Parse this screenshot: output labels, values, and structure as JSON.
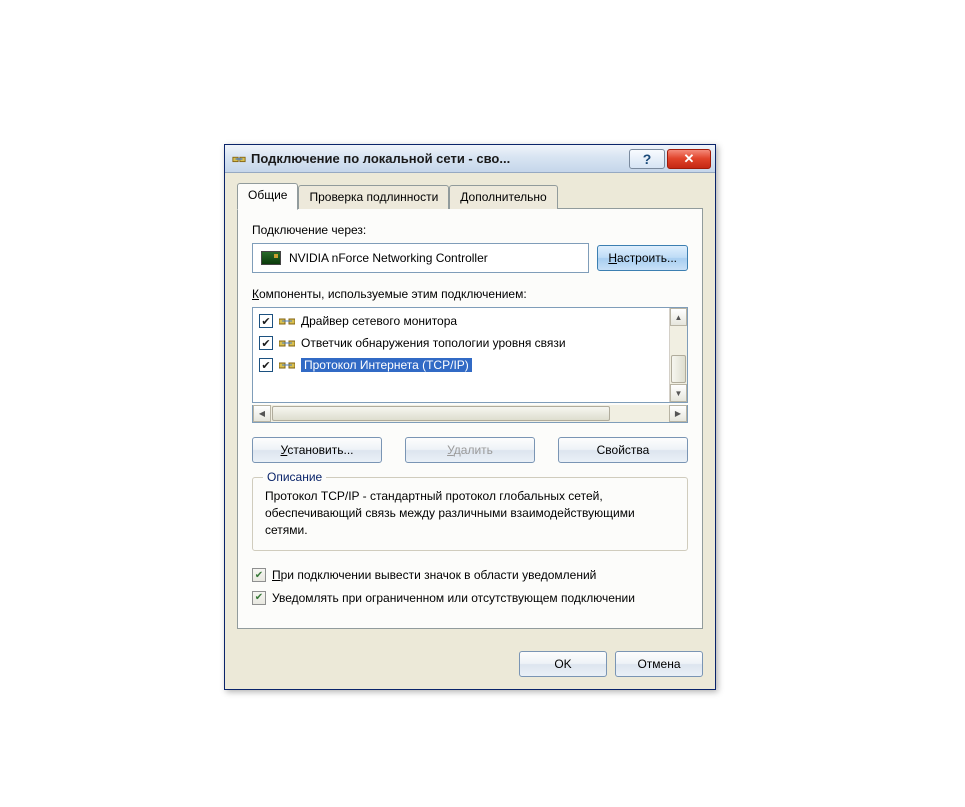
{
  "title": "Подключение по локальной сети - сво...",
  "tabs": {
    "general": "Общие",
    "auth": "Проверка подлинности",
    "advanced": "Дополнительно"
  },
  "connect_using_label": "Подключение через:",
  "adapter_name": "NVIDIA nForce Networking Controller",
  "configure_btn": "Настроить...",
  "components_label": "Компоненты, используемые этим подключением:",
  "components": [
    {
      "checked": true,
      "selected": false,
      "label": "Драйвер сетевого монитора"
    },
    {
      "checked": true,
      "selected": false,
      "label": "Ответчик обнаружения топологии уровня связи"
    },
    {
      "checked": true,
      "selected": true,
      "label": "Протокол Интернета (TCP/IP)"
    }
  ],
  "install_btn": "Установить...",
  "uninstall_btn": "Удалить",
  "properties_btn": "Свойства",
  "description_title": "Описание",
  "description_text": "Протокол TCP/IP - стандартный протокол глобальных сетей, обеспечивающий связь между различными взаимодействующими сетями.",
  "show_icon_label": "При подключении вывести значок в области уведомлений",
  "notify_limited_label": "Уведомлять при ограниченном или отсутствующем подключении",
  "ok_btn": "OK",
  "cancel_btn": "Отмена"
}
